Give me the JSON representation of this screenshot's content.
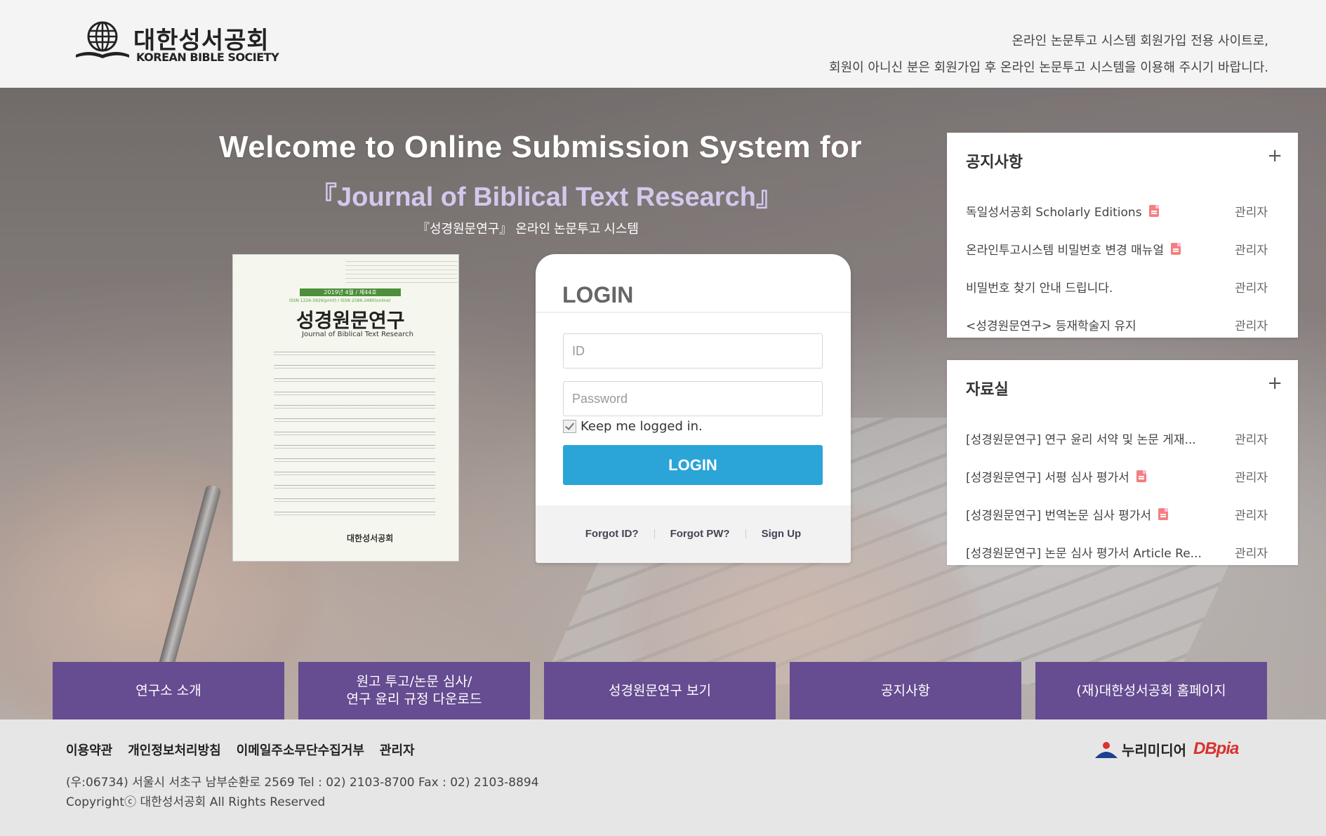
{
  "header": {
    "logo_ko": "대한성서공회",
    "logo_en": "KOREAN BIBLE SOCIETY",
    "notice_line1": "온라인 논문투고 시스템 회원가입 전용 사이트로,",
    "notice_line2": "회원이 아니신 분은 회원가입 후 온라인 논문투고 시스템을 이용해 주시기 바랍니다."
  },
  "hero": {
    "welcome_line1": "Welcome to Online Submission System for",
    "welcome_line2": "『Journal of Biblical Text Research』",
    "welcome_line3": "『성경원문연구』 온라인 논문투고 시스템"
  },
  "cover": {
    "issue": "2019년 4월 / 제44호",
    "issn": "ISSN 1226-5926(print) / ISSN 2586-2480(online)",
    "title": "성경원문연구",
    "subtitle": "Journal of Biblical Text Research",
    "publisher": "대한성서공회"
  },
  "login": {
    "title": "LOGIN",
    "id_placeholder": "ID",
    "password_placeholder": "Password",
    "keep_label": "Keep me logged in.",
    "button_label": "LOGIN",
    "forgot_id": "Forgot ID?",
    "forgot_pw": "Forgot PW?",
    "sign_up": "Sign Up"
  },
  "notice_panel": {
    "title": "공지사항",
    "plus": "+",
    "items": [
      {
        "title": "독일성서공회 Scholarly Editions",
        "author": "관리자",
        "has_file": true
      },
      {
        "title": "온라인투고시스템 비밀번호 변경 매뉴얼",
        "author": "관리자",
        "has_file": true
      },
      {
        "title": "비밀번호 찾기 안내 드립니다.",
        "author": "관리자",
        "has_file": false
      },
      {
        "title": "<성경원문연구> 등재학술지 유지",
        "author": "관리자",
        "has_file": false
      }
    ]
  },
  "files_panel": {
    "title": "자료실",
    "plus": "+",
    "items": [
      {
        "title": "[성경원문연구] 연구 윤리 서약 및 논문 게재...",
        "author": "관리자",
        "has_file": false
      },
      {
        "title": "[성경원문연구] 서평 심사 평가서",
        "author": "관리자",
        "has_file": true
      },
      {
        "title": "[성경원문연구] 번역논문 심사 평가서",
        "author": "관리자",
        "has_file": true
      },
      {
        "title": "[성경원문연구] 논문 심사 평가서 Article Re...",
        "author": "관리자",
        "has_file": false
      }
    ]
  },
  "nav": [
    "연구소 소개",
    "원고 투고/논문 심사/\n연구 윤리 규정 다운로드",
    "성경원문연구 보기",
    "공지사항",
    "(재)대한성서공회 홈페이지"
  ],
  "footer": {
    "links": [
      "이용약관",
      "개인정보처리방침",
      "이메일주소무단수집거부",
      "관리자"
    ],
    "address": "(우:06734) 서울시 서초구 남부순환로 2569 Tel : 02) 2103-8700 Fax : 02) 2103-8894",
    "copyright": "Copyrightⓒ 대한성서공회 All Rights Reserved",
    "partner1": "누리미디어",
    "partner2": "DBpia"
  },
  "colors": {
    "nav_purple": "#664c91",
    "login_blue": "#2ba4d8",
    "file_icon": "#f47f7f"
  }
}
